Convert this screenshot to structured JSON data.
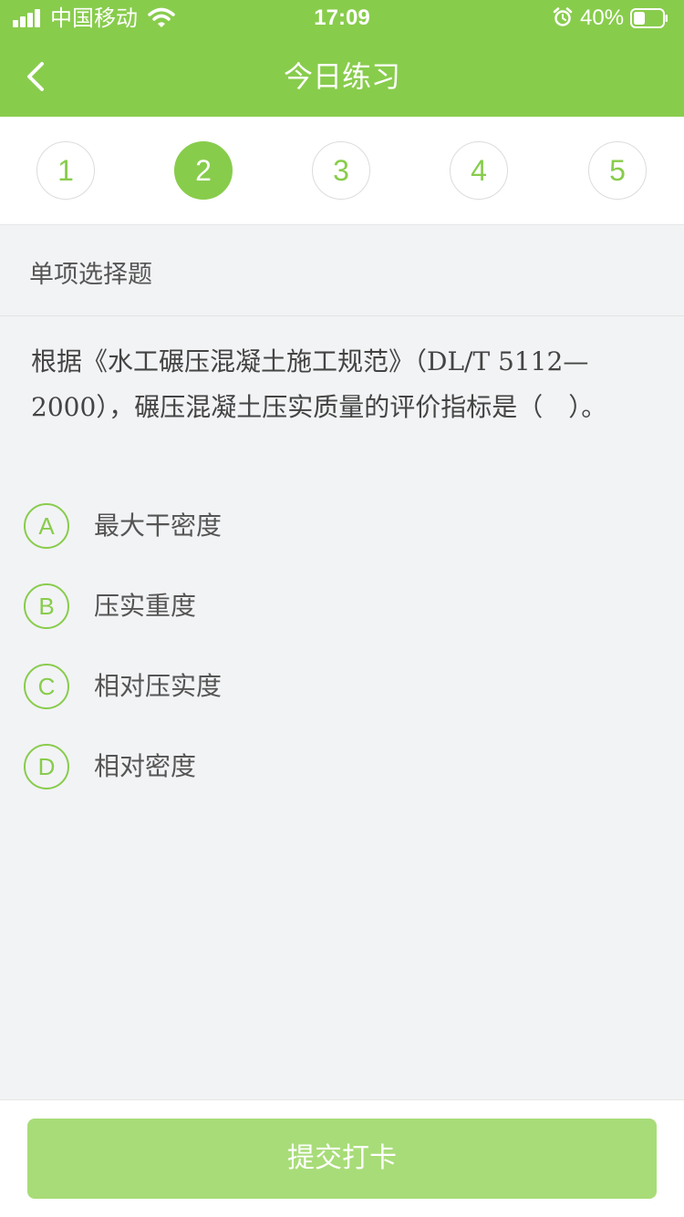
{
  "status_bar": {
    "carrier": "中国移动",
    "time": "17:09",
    "battery_percent": "40%",
    "battery_level": 0.4,
    "icons": [
      "signal-icon",
      "wifi-icon",
      "alarm-icon",
      "battery-icon"
    ]
  },
  "nav": {
    "title": "今日练习",
    "back_icon": "chevron-left-icon"
  },
  "steps": {
    "items": [
      "1",
      "2",
      "3",
      "4",
      "5"
    ],
    "active_index": 1
  },
  "question": {
    "type_label": "单项选择题",
    "text": "根据《水工碾压混凝土施工规范》（DL/T 5112—2000），碾压混凝土压实质量的评价指标是（　）。",
    "options": [
      {
        "letter": "A",
        "text": "最大干密度"
      },
      {
        "letter": "B",
        "text": "压实重度"
      },
      {
        "letter": "C",
        "text": "相对压实度"
      },
      {
        "letter": "D",
        "text": "相对密度"
      }
    ]
  },
  "footer": {
    "submit_label": "提交打卡"
  },
  "colors": {
    "brand_green": "#88cc4c",
    "button_disabled_green": "#a8dc78",
    "background": "#f2f3f5"
  }
}
